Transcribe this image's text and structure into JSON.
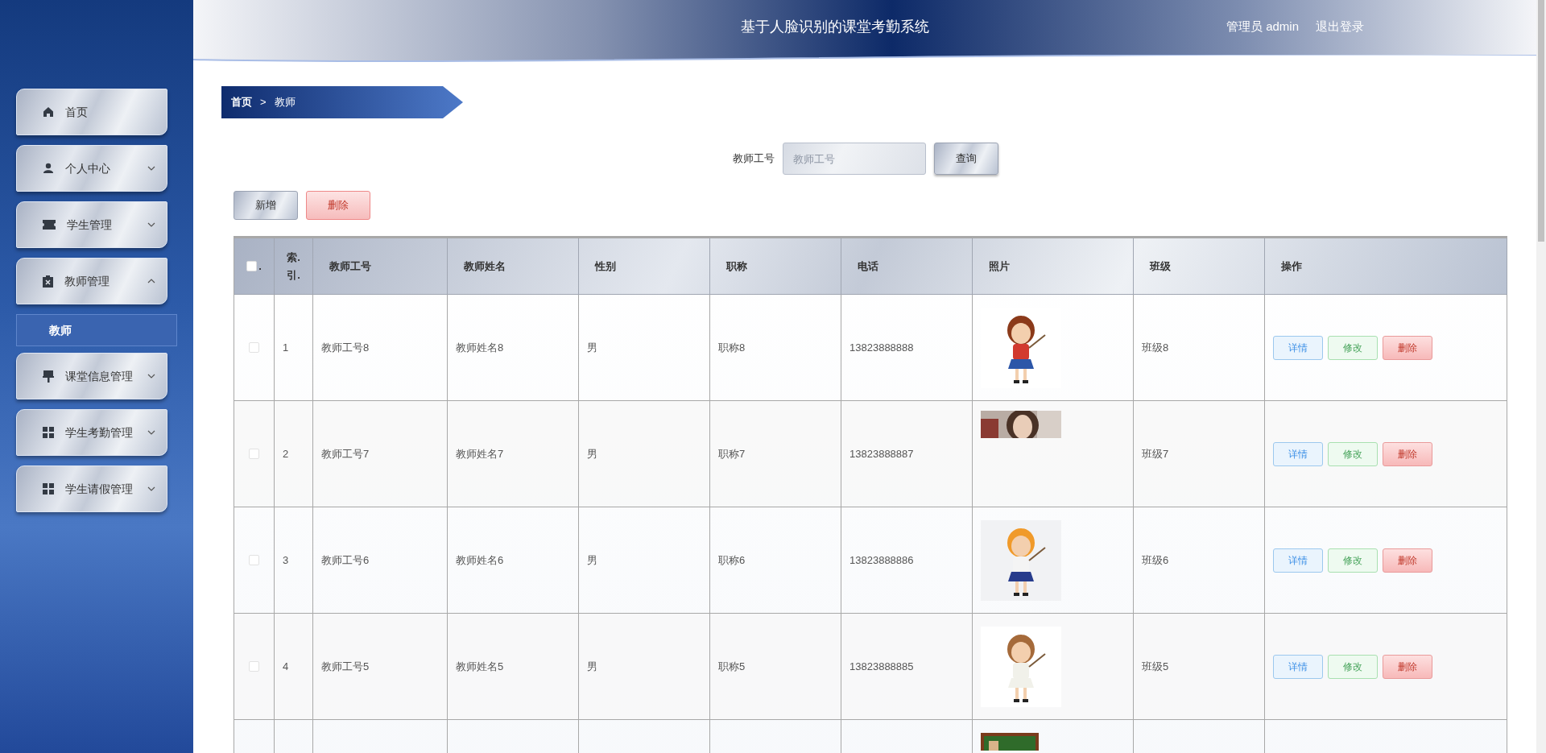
{
  "header": {
    "title": "基于人脸识别的课堂考勤系统",
    "user": "管理员 admin",
    "logout": "退出登录"
  },
  "sidebar": {
    "items": [
      {
        "label": "首页",
        "kind": "home",
        "has_children": false
      },
      {
        "label": "个人中心",
        "kind": "person",
        "expanded": false,
        "has_children": true
      },
      {
        "label": "学生管理",
        "kind": "ticket",
        "expanded": false,
        "has_children": true
      },
      {
        "label": "教师管理",
        "kind": "clipboard",
        "expanded": true,
        "has_children": true,
        "children": [
          {
            "label": "教师",
            "selected": true
          }
        ]
      },
      {
        "label": "课堂信息管理",
        "kind": "brush",
        "expanded": false,
        "has_children": true
      },
      {
        "label": "学生考勤管理",
        "kind": "grid",
        "expanded": false,
        "has_children": true
      },
      {
        "label": "学生请假管理",
        "kind": "grid",
        "expanded": false,
        "has_children": true
      }
    ]
  },
  "breadcrumb": [
    "首页",
    "教师"
  ],
  "breadcrumb_separator": ">",
  "search": {
    "label": "教师工号",
    "placeholder": "教师工号",
    "button": "查询"
  },
  "actions": [
    {
      "label": "新增",
      "kind": "plain"
    },
    {
      "label": "删除",
      "kind": "danger"
    }
  ],
  "table": {
    "header_checked": false,
    "header_mark": ".",
    "columns": [
      "索.引.",
      "教师工号",
      "教师姓名",
      "性别",
      "职称",
      "电话",
      "照片",
      "班级",
      "操作"
    ],
    "rows": [
      {
        "kind": "full",
        "checked": false,
        "index": "1",
        "id": "教师工号8",
        "name": "教师姓名8",
        "gender": "男",
        "title": "职称8",
        "phone": "13823888888",
        "class": "班级8",
        "ops": [
          "详情",
          "修改",
          "删除"
        ]
      },
      {
        "kind": "full",
        "checked": false,
        "index": "2",
        "id": "教师工号7",
        "name": "教师姓名7",
        "gender": "男",
        "title": "职称7",
        "phone": "13823888887",
        "class": "班级7",
        "ops": [
          "详情",
          "修改",
          "删除"
        ]
      },
      {
        "kind": "full",
        "checked": false,
        "index": "3",
        "id": "教师工号6",
        "name": "教师姓名6",
        "gender": "男",
        "title": "职称6",
        "phone": "13823888886",
        "class": "班级6",
        "ops": [
          "详情",
          "修改",
          "删除"
        ]
      },
      {
        "kind": "full",
        "checked": false,
        "index": "4",
        "id": "教师工号5",
        "name": "教师姓名5",
        "gender": "男",
        "title": "职称5",
        "phone": "13823888885",
        "class": "班级5",
        "ops": [
          "详情",
          "修改",
          "删除"
        ]
      },
      {
        "kind": "cut"
      }
    ]
  }
}
